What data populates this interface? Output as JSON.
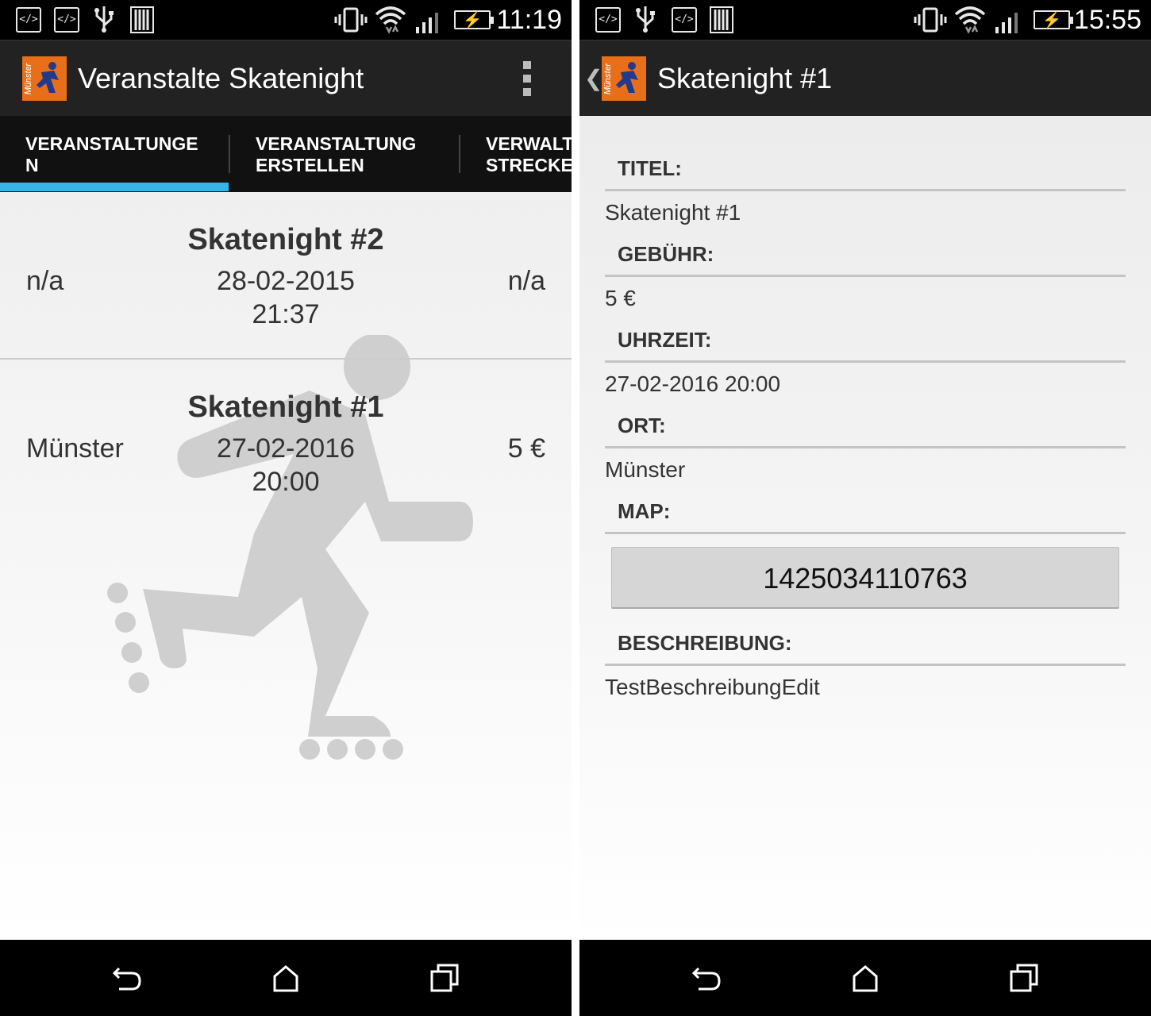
{
  "left_screen": {
    "status_bar": {
      "time": "11:19",
      "icons": [
        "code-icon",
        "code-icon",
        "usb-icon",
        "storage-icon",
        "vibrate-icon",
        "wifi-icon",
        "signal-icon",
        "battery-charging-icon"
      ]
    },
    "action_bar": {
      "title": "Veranstalte Skatenight",
      "logo_text": "Münster"
    },
    "tabs": [
      {
        "label": "VERANSTALTUNGE\nN",
        "selected": true
      },
      {
        "label": "VERANSTALTUNG\nERSTELLEN",
        "selected": false
      },
      {
        "label": "VERWALTEN\nSTRECKEN",
        "selected": false
      }
    ],
    "events": [
      {
        "title": "Skatenight #2",
        "place": "n/a",
        "date": "28-02-2015",
        "time": "21:37",
        "fee": "n/a"
      },
      {
        "title": "Skatenight #1",
        "place": "Münster",
        "date": "27-02-2016",
        "time": "20:00",
        "fee": "5 €"
      }
    ]
  },
  "right_screen": {
    "status_bar": {
      "time": "15:55",
      "icons": [
        "code-icon",
        "usb-icon",
        "code-icon",
        "storage-icon",
        "vibrate-icon",
        "wifi-icon",
        "signal-icon",
        "battery-charging-icon"
      ]
    },
    "action_bar": {
      "title": "Skatenight #1",
      "logo_text": "Münster"
    },
    "details": {
      "titel_label": "TITEL:",
      "titel_value": "Skatenight #1",
      "gebuehr_label": "GEBÜHR:",
      "gebuehr_value": "5 €",
      "uhrzeit_label": "UHRZEIT:",
      "uhrzeit_value": "27-02-2016 20:00",
      "ort_label": "ORT:",
      "ort_value": "Münster",
      "map_label": "MAP:",
      "map_button": "1425034110763",
      "beschreibung_label": "BESCHREIBUNG:",
      "beschreibung_value": "TestBeschreibungEdit"
    }
  },
  "colors": {
    "status_bar": "#000000",
    "action_bar": "#222222",
    "tab_bar": "#111111",
    "tab_indicator": "#33b5e5",
    "logo_orange": "#e86f1a",
    "skater_watermark": "#cfcfcf"
  }
}
